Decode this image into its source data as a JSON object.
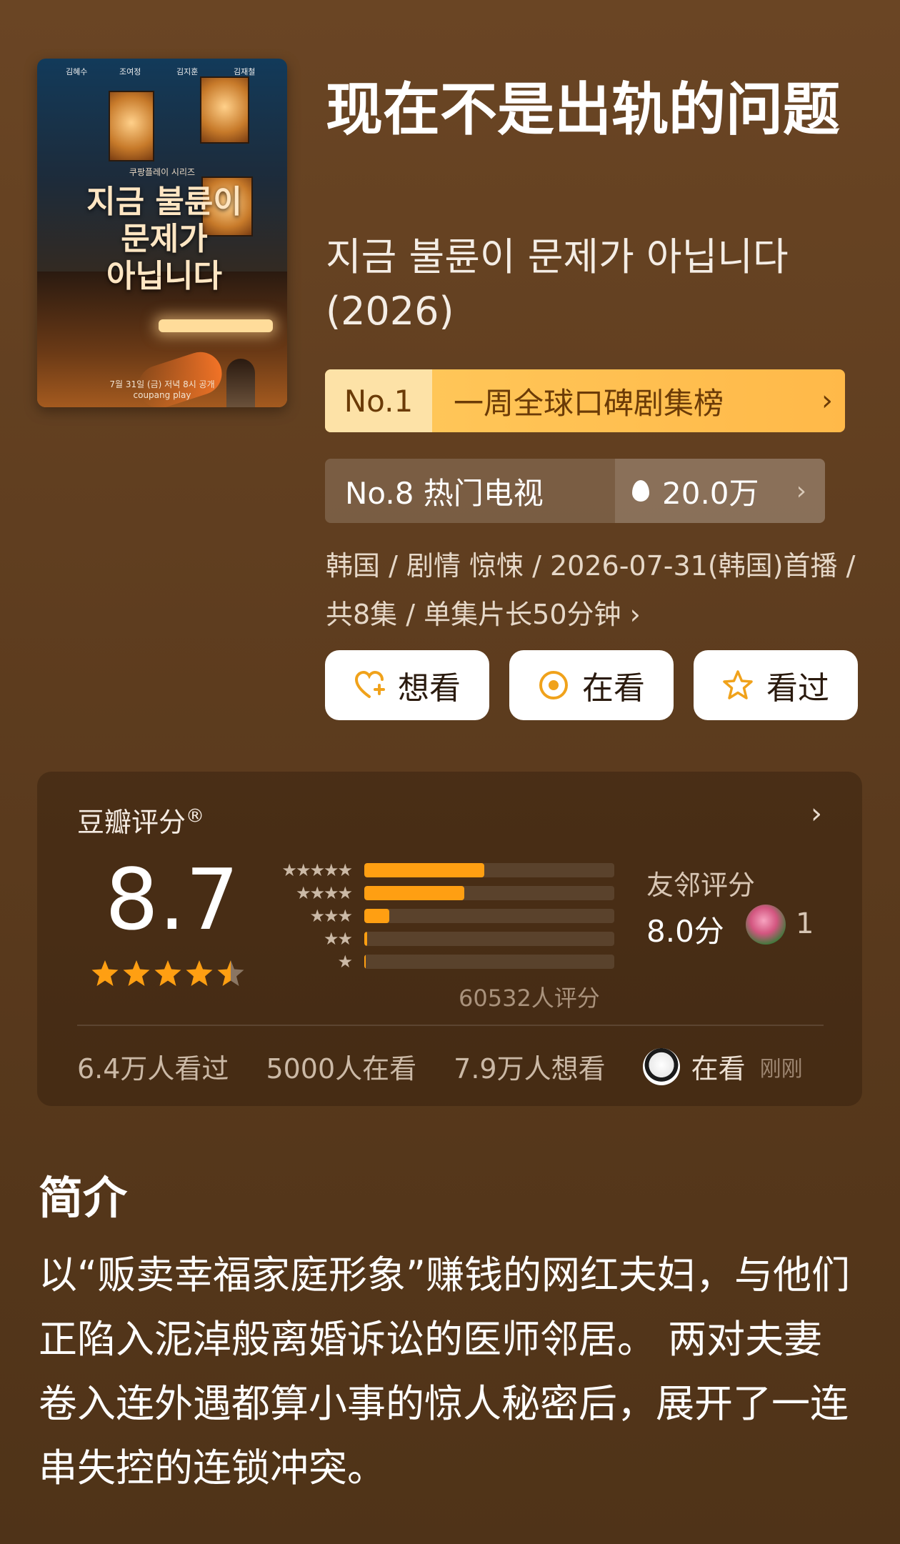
{
  "poster": {
    "cast": [
      "김혜수",
      "조여정",
      "김지훈",
      "김재철"
    ],
    "series_line": "쿠팡플레이 시리즈",
    "title_lines": [
      "지금 불륜이",
      "문제가",
      "아닙니다"
    ],
    "release_line": "7월 31일 (금) 저녁 8시 공개",
    "brand": "coupang play"
  },
  "title": "现在不是出轨的问题",
  "original_title": "지금 불륜이 문제가 아닙니다 (2026)",
  "rank_badge": {
    "number": "No.1",
    "label": "一周全球口碑剧集榜",
    "chevron": "›"
  },
  "hot_badge": {
    "label": "No.8 热门电视",
    "heat": "20.0万",
    "chevron": "›"
  },
  "meta_text": "韩国 / 剧情 惊悚 / 2026-07-31(韩国)首播 / 共8集 / 单集片长50分钟 ›",
  "buttons": [
    {
      "label": "想看",
      "icon": "heart-plus-icon"
    },
    {
      "label": "在看",
      "icon": "target-circle-icon"
    },
    {
      "label": "看过",
      "icon": "star-outline-icon"
    }
  ],
  "rating": {
    "title": "豆瓣评分",
    "registered": "®",
    "score": "8.7",
    "stars": 4.5,
    "star_labels": [
      "★★★★★",
      "★★★★",
      "★★★",
      "★★",
      "★"
    ],
    "distribution": [
      0.48,
      0.4,
      0.1,
      0.012,
      0.006
    ],
    "count": "60532人评分",
    "friend_title": "友邻评分",
    "friend_score": "8.0分",
    "friend_count": "1"
  },
  "stats": {
    "watched": "6.4万人看过",
    "watching": "5000人在看",
    "want": "7.9万人想看",
    "activity_state": "在看",
    "activity_time": "刚刚"
  },
  "intro": {
    "title": "简介",
    "text": "以“贩卖幸福家庭形象”赚钱的网红夫妇，与他们正陷入泥淖般离婚诉讼的医师邻居。 两对夫妻卷入连外遇都算小事的惊人秘密后，展开了一连串失控的连锁冲突。"
  },
  "colors": {
    "accent": "#ff9f12",
    "rank_bg": "#ffbf52",
    "background": "#5e3d1f"
  }
}
